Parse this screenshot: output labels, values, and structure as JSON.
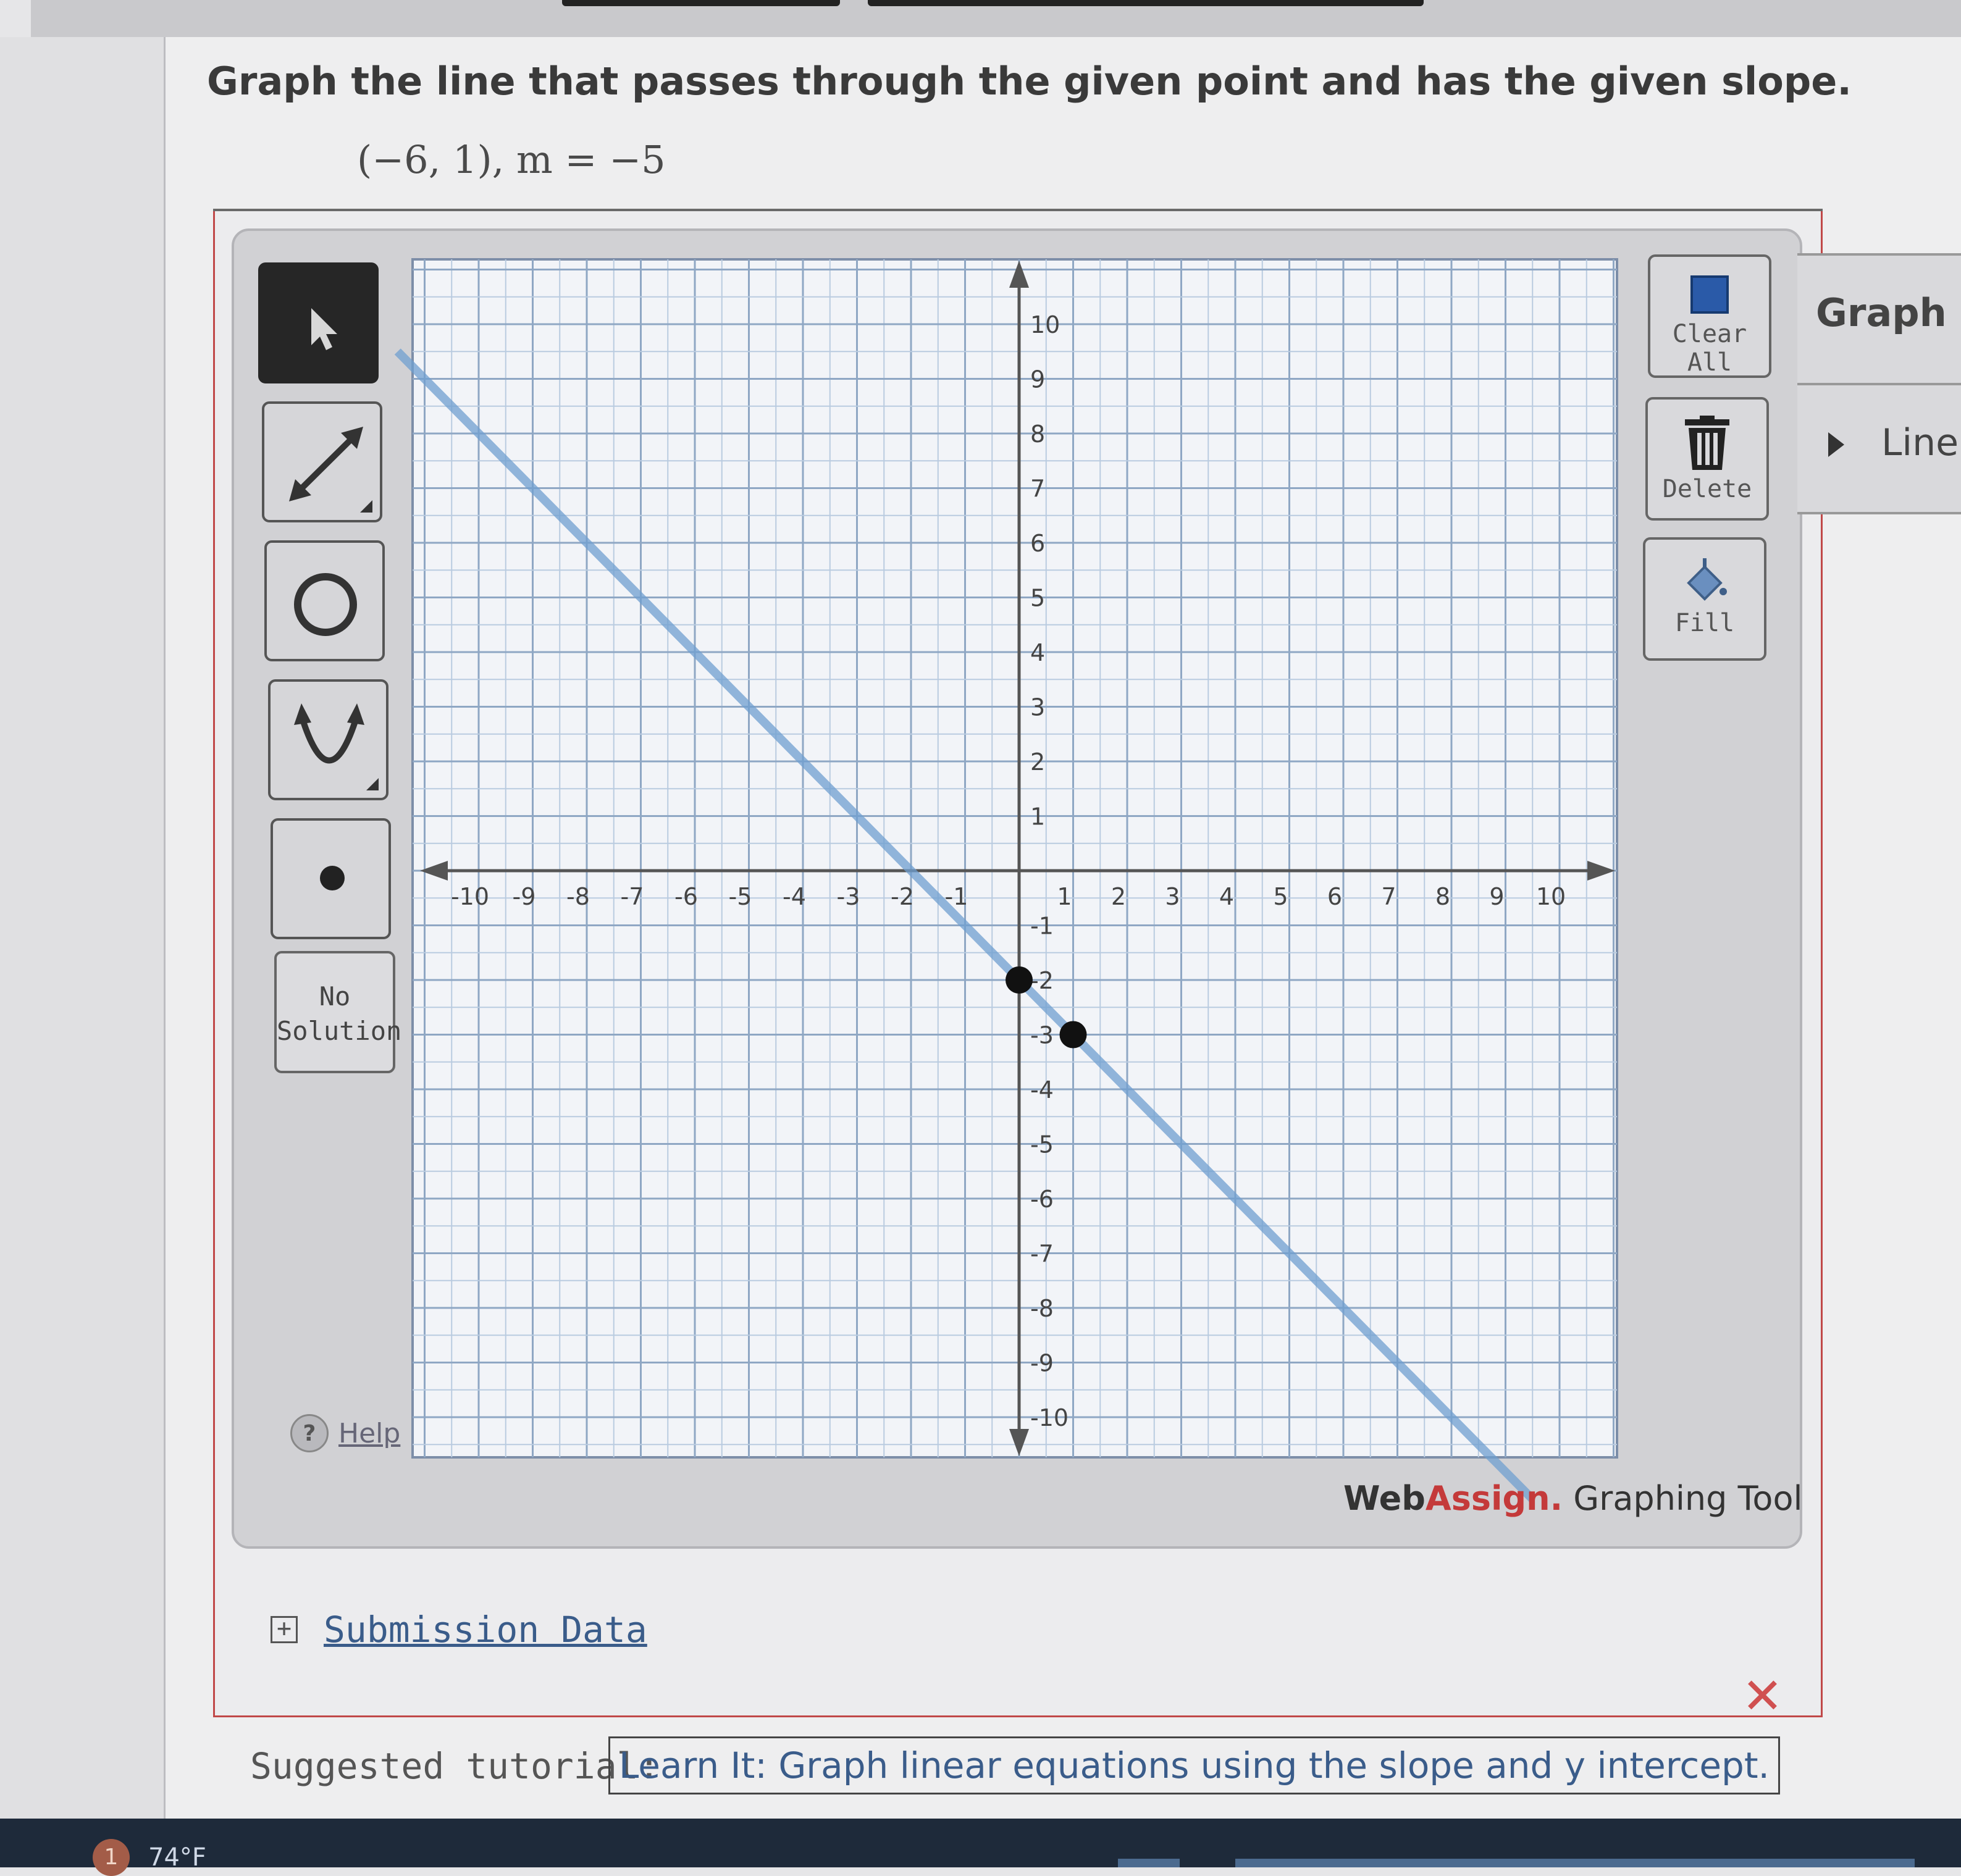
{
  "question": {
    "prompt": "Graph the line that passes through the given point and has the given slope.",
    "given": "(−6, 1), m = −5"
  },
  "toolbar": {
    "no_solution_line1": "No",
    "no_solution_line2": "Solution",
    "help_label": "Help",
    "help_icon_glyph": "?"
  },
  "right_tools": {
    "clear_all": "Clear All",
    "delete": "Delete",
    "fill": "Fill"
  },
  "side_panel": {
    "title": "Graph L",
    "line_item": "Line"
  },
  "brand": {
    "web": "Web",
    "assign": "Assign.",
    "suffix": " Graphing Tool"
  },
  "submission": {
    "label": "Submission Data",
    "expand_glyph": "+"
  },
  "tutorial": {
    "label": "Suggested tutorial:",
    "link": "Learn It: Graph linear equations using the slope and y intercept."
  },
  "taskbar": {
    "badge": "1",
    "temperature": "74°F"
  },
  "status_mark": "✕",
  "colors": {
    "line": "#6f9fd0",
    "grid_minor": "#b9cbe0",
    "grid_major": "#8fa7c4",
    "incorrect": "#d05050",
    "brand_red": "#c43a3a"
  },
  "graph": {
    "x_range": [
      -10,
      10
    ],
    "y_range": [
      -10,
      10
    ],
    "x_ticks": [
      -10,
      -9,
      -8,
      -7,
      -6,
      -5,
      -4,
      -3,
      -2,
      -1,
      1,
      2,
      3,
      4,
      5,
      6,
      7,
      8,
      9,
      10
    ],
    "y_ticks": [
      10,
      9,
      8,
      7,
      6,
      5,
      4,
      3,
      2,
      1,
      -1,
      -2,
      -3,
      -4,
      -5,
      -6,
      -7,
      -8,
      -9,
      -10
    ],
    "points": [
      {
        "x": 0,
        "y": -2
      },
      {
        "x": 1,
        "y": -3
      }
    ],
    "line": {
      "slope": -1,
      "intercept": -2
    }
  }
}
